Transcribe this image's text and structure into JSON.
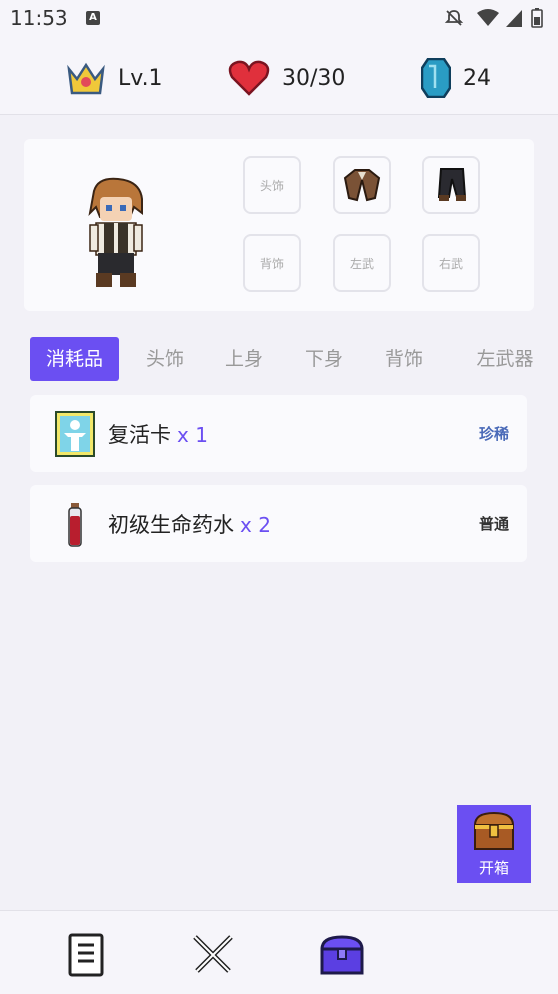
{
  "status_bar": {
    "time": "11:53"
  },
  "stats": {
    "level": "Lv.1",
    "hp": "30/30",
    "gems": "24"
  },
  "equip_slots": [
    "头饰",
    "背饰",
    "左武",
    "右武"
  ],
  "tabs": [
    "消耗品",
    "头饰",
    "上身",
    "下身",
    "背饰",
    "左武器"
  ],
  "active_tab": "消耗品",
  "items": [
    {
      "name": "复活卡",
      "count": "x 1",
      "rarity": "珍稀",
      "rarity_color": "#4a6ab8"
    },
    {
      "name": "初级生命药水",
      "count": "x 2",
      "rarity": "普通",
      "rarity_color": "#333333"
    }
  ],
  "chest_button": {
    "label": "开箱"
  },
  "colors": {
    "accent": "#6b4ff2",
    "background": "#f2f1f7"
  }
}
